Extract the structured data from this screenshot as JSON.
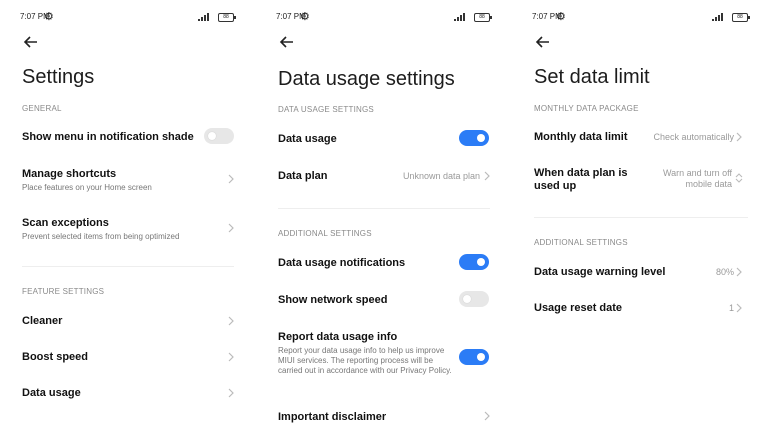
{
  "status_bar": {
    "time": "7:07 PM",
    "battery": "88"
  },
  "colors": {
    "accent": "#2b7cf6",
    "toggle_off": "#e7e7e7"
  },
  "screen1": {
    "title": "Settings",
    "section_general": "GENERAL",
    "show_menu": "Show menu in notification shade",
    "show_menu_on": false,
    "manage_shortcuts": "Manage shortcuts",
    "manage_shortcuts_sub": "Place features on your Home screen",
    "scan_exceptions": "Scan exceptions",
    "scan_exceptions_sub": "Prevent selected items from being optimized",
    "section_feature": "FEATURE SETTINGS",
    "cleaner": "Cleaner",
    "boost_speed": "Boost speed",
    "data_usage": "Data usage"
  },
  "screen2": {
    "title": "Data usage settings",
    "section_data": "DATA USAGE SETTINGS",
    "data_usage": "Data usage",
    "data_usage_on": true,
    "data_plan": "Data plan",
    "data_plan_value": "Unknown data plan",
    "section_additional": "ADDITIONAL SETTINGS",
    "notifications": "Data usage notifications",
    "notifications_on": true,
    "network_speed": "Show network speed",
    "network_speed_on": false,
    "report": "Report data usage info",
    "report_sub": "Report your data usage info to help us improve MIUI services. The reporting process will be carried out in accordance with our Privacy Policy.",
    "report_on": true,
    "disclaimer": "Important disclaimer"
  },
  "screen3": {
    "title": "Set data limit",
    "section_monthly": "MONTHLY DATA PACKAGE",
    "monthly_limit": "Monthly data limit",
    "monthly_limit_value": "Check automatically",
    "when_used_up": "When data plan is used up",
    "when_used_up_value": "Warn and turn off mobile data",
    "section_additional": "ADDITIONAL SETTINGS",
    "warning_level": "Data usage warning level",
    "warning_level_value": "80%",
    "reset_date": "Usage reset date",
    "reset_date_value": "1"
  }
}
